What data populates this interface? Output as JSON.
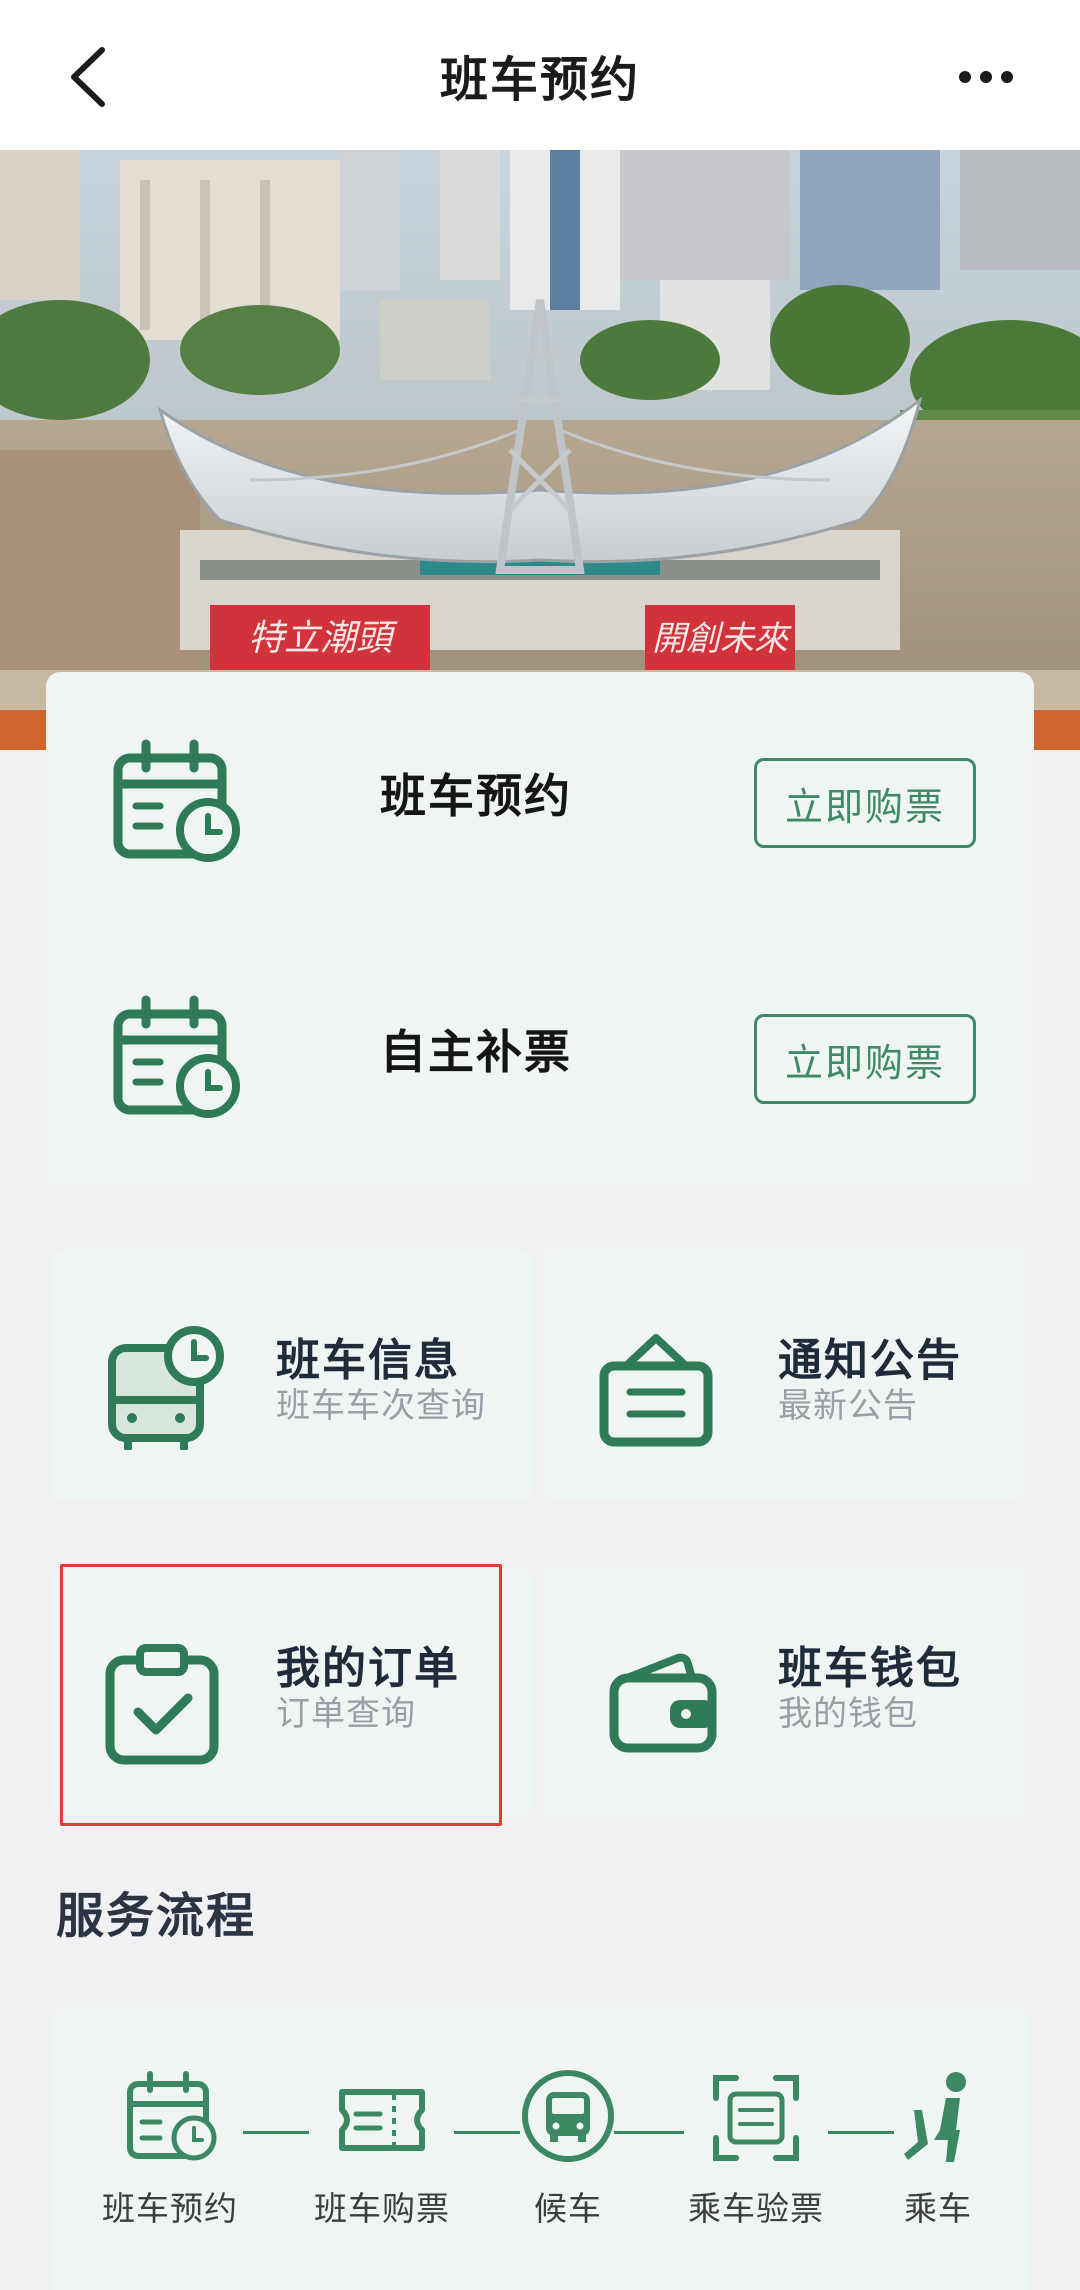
{
  "header": {
    "title": "班车预约"
  },
  "booking": [
    {
      "label": "班车预约",
      "button": "立即购票"
    },
    {
      "label": "自主补票",
      "button": "立即购票"
    }
  ],
  "tiles": [
    {
      "title": "班车信息",
      "subtitle": "班车车次查询",
      "icon": "bus-clock-icon"
    },
    {
      "title": "通知公告",
      "subtitle": "最新公告",
      "icon": "notice-board-icon"
    },
    {
      "title": "我的订单",
      "subtitle": "订单查询",
      "icon": "clipboard-check-icon"
    },
    {
      "title": "班车钱包",
      "subtitle": "我的钱包",
      "icon": "wallet-icon"
    }
  ],
  "process": {
    "title": "服务流程",
    "steps": [
      "班车预约",
      "班车购票",
      "候车",
      "乘车验票",
      "乘车"
    ]
  },
  "colors": {
    "accent": "#2f7a57",
    "card_bg": "#eff5f2",
    "page_bg": "#f1f1f4",
    "highlight": "#e53935"
  }
}
